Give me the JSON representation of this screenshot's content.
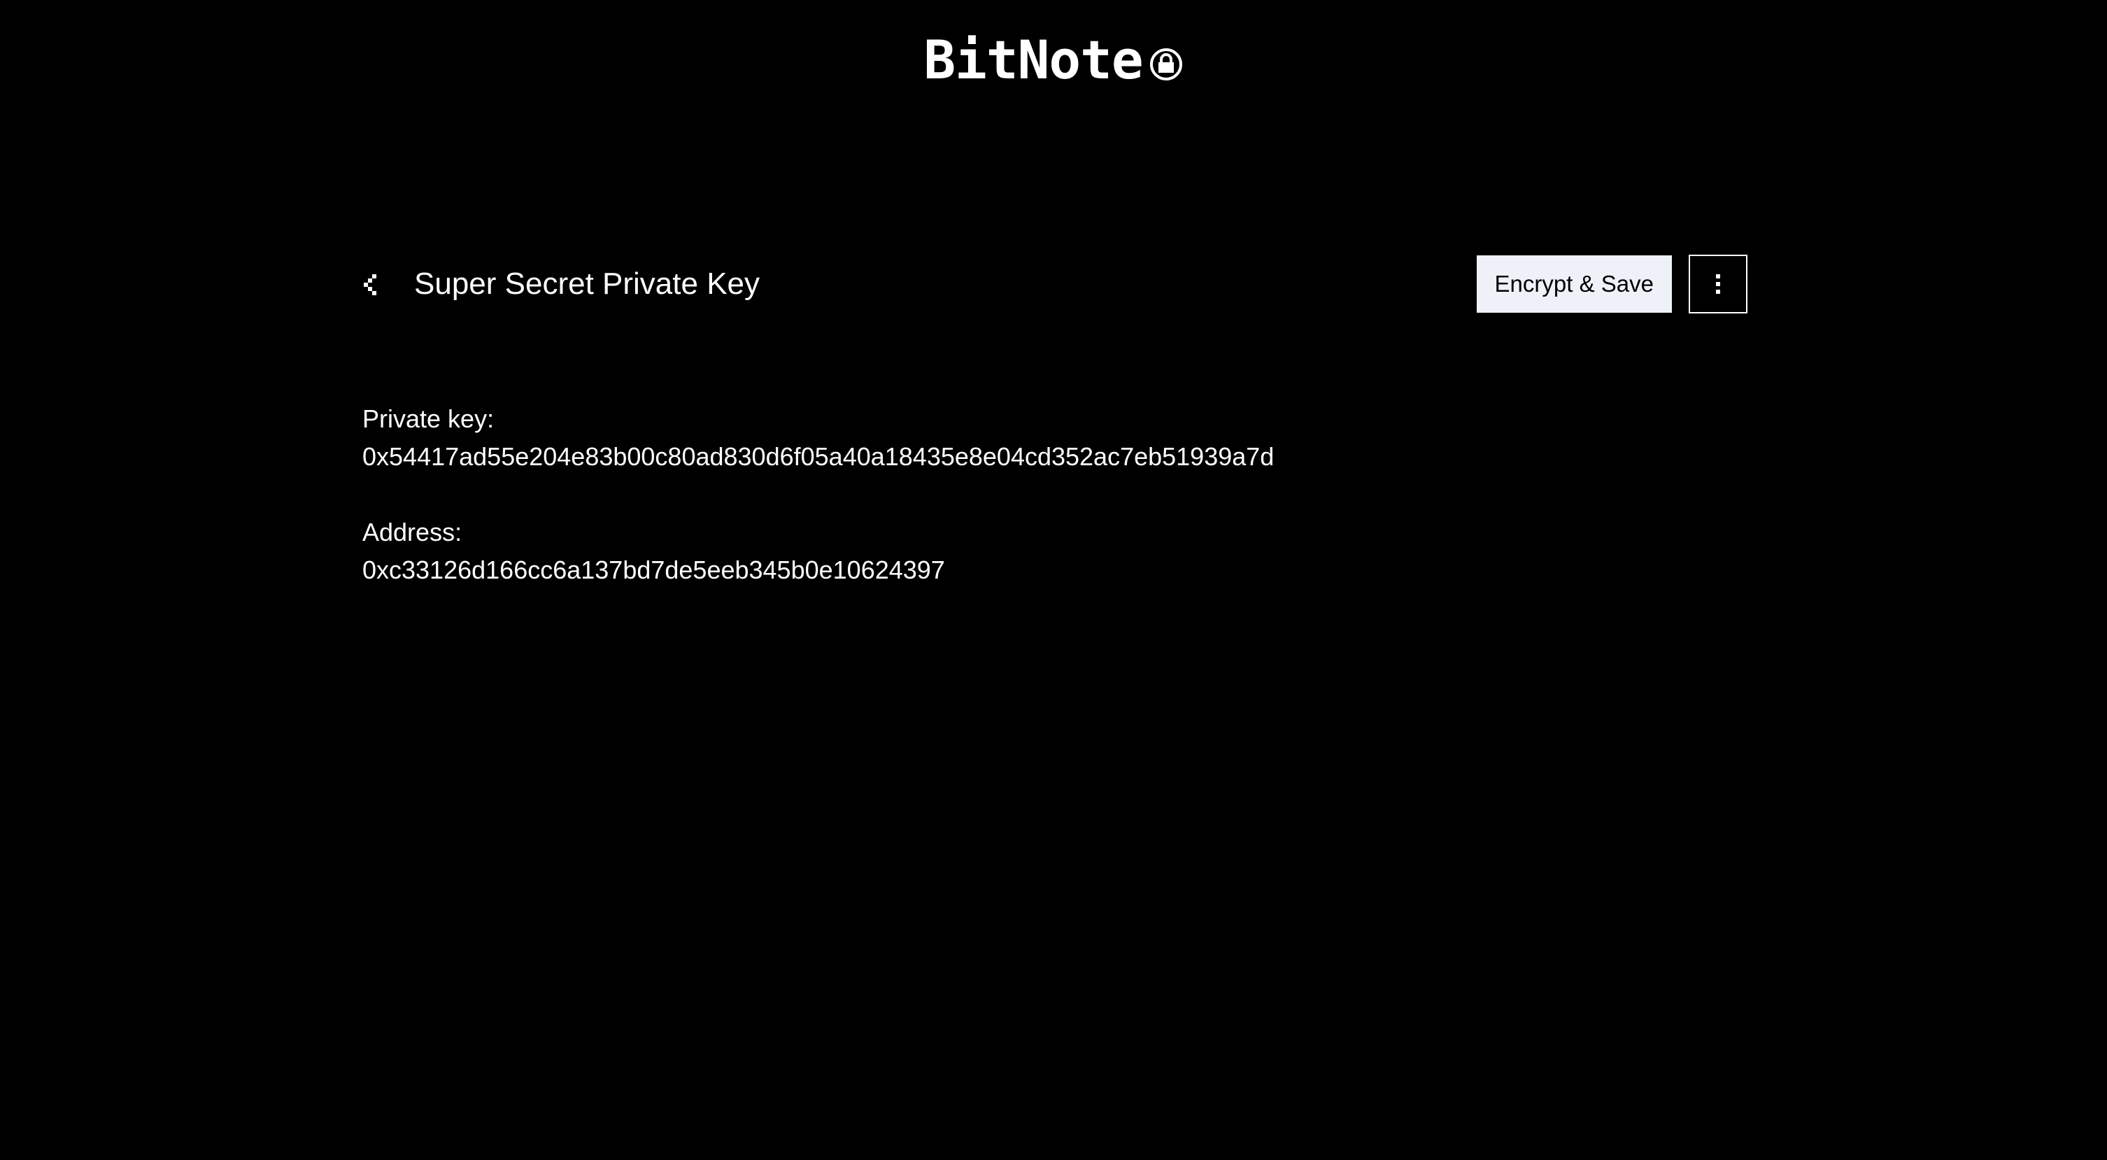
{
  "app": {
    "logo_text": "BitNote",
    "logo_icon": "lock-icon"
  },
  "note": {
    "back_icon": "chevron-left-icon",
    "title": "Super Secret Private Key",
    "encrypt_save_label": "Encrypt & Save",
    "menu_icon": "vertical-dots-icon"
  },
  "content": {
    "private_key_label": "Private key:",
    "private_key_value": "0x54417ad55e204e83b00c80ad830d6f05a40a18435e8e04cd352ac7eb51939a7d",
    "address_label": "Address:",
    "address_value": "0xc33126d166cc6a137bd7de5eeb345b0e10624397"
  },
  "colors": {
    "background": "#000000",
    "text": "#ffffff",
    "button_bg": "#eef1f8",
    "button_text": "#000000"
  }
}
